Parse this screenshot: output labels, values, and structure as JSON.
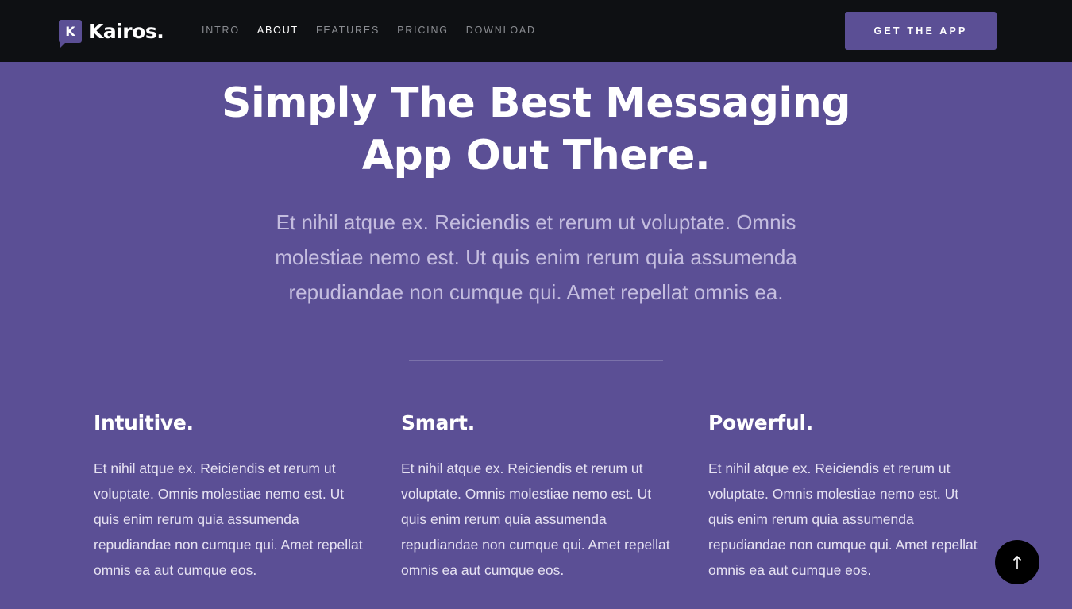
{
  "brand": {
    "mark": "K",
    "name": "Kairos."
  },
  "nav": {
    "items": [
      {
        "label": "INTRO",
        "active": false
      },
      {
        "label": "ABOUT",
        "active": true
      },
      {
        "label": "FEATURES",
        "active": false
      },
      {
        "label": "PRICING",
        "active": false
      },
      {
        "label": "DOWNLOAD",
        "active": false
      }
    ],
    "cta_label": "GET THE APP"
  },
  "hero": {
    "title_line1": "Simply The Best Messaging",
    "title_line2": "App Out There.",
    "lead": "Et nihil atque ex. Reiciendis et rerum ut voluptate. Omnis molestiae nemo est. Ut quis enim rerum quia assumenda repudiandae non cumque qui. Amet repellat omnis ea."
  },
  "features": [
    {
      "title": "Intuitive.",
      "text": "Et nihil atque ex. Reiciendis et rerum ut voluptate. Omnis molestiae nemo est. Ut quis enim rerum quia assumenda repudiandae non cumque qui. Amet repellat omnis ea aut cumque eos."
    },
    {
      "title": "Smart.",
      "text": "Et nihil atque ex. Reiciendis et rerum ut voluptate. Omnis molestiae nemo est. Ut quis enim rerum quia assumenda repudiandae non cumque qui. Amet repellat omnis ea aut cumque eos."
    },
    {
      "title": "Powerful.",
      "text": "Et nihil atque ex. Reiciendis et rerum ut voluptate. Omnis molestiae nemo est. Ut quis enim rerum quia assumenda repudiandae non cumque qui. Amet repellat omnis ea aut cumque eos."
    }
  ],
  "icons": {
    "back_to_top": "arrow-up-icon"
  },
  "colors": {
    "accent": "#5b4f95",
    "header_bg": "#0e1013",
    "nav_inactive": "#8a8c91"
  }
}
